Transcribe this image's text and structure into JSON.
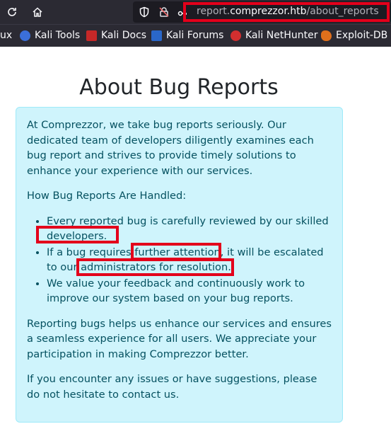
{
  "browser": {
    "url_prefix": "report.",
    "url_host": "comprezzor.htb",
    "url_path": "/about_reports"
  },
  "bookmarks": [
    {
      "label": "ux",
      "icon": "kali-linux-icon"
    },
    {
      "label": "Kali Tools",
      "icon": "kali-tools-icon"
    },
    {
      "label": "Kali Docs",
      "icon": "kali-docs-icon"
    },
    {
      "label": "Kali Forums",
      "icon": "kali-forums-icon"
    },
    {
      "label": "Kali NetHunter",
      "icon": "kali-nethunter-icon"
    },
    {
      "label": "Exploit-DB",
      "icon": "exploit-db-icon"
    }
  ],
  "page": {
    "title": "About Bug Reports",
    "intro": "At Comprezzor, we take bug reports seriously. Our dedicated team of developers diligently examines each bug report and strives to provide timely solutions to enhance your experience with our services.",
    "subheading": "How Bug Reports Are Handled:",
    "bullets": [
      "Every reported bug is carefully reviewed by our skilled developers.",
      "If a bug requires further attention, it will be escalated to our administrators for resolution.",
      "We value your feedback and continuously work to improve our system based on your bug reports."
    ],
    "para2": "Reporting bugs helps us enhance our services and ensures a seamless experience for all users. We appreciate your participation in making Comprezzor better.",
    "para3": "If you encounter any issues or have suggestions, please do not hesitate to contact us."
  },
  "colors": {
    "highlight": "#e3001b",
    "card_bg": "#cff4fc",
    "card_text": "#055160"
  }
}
